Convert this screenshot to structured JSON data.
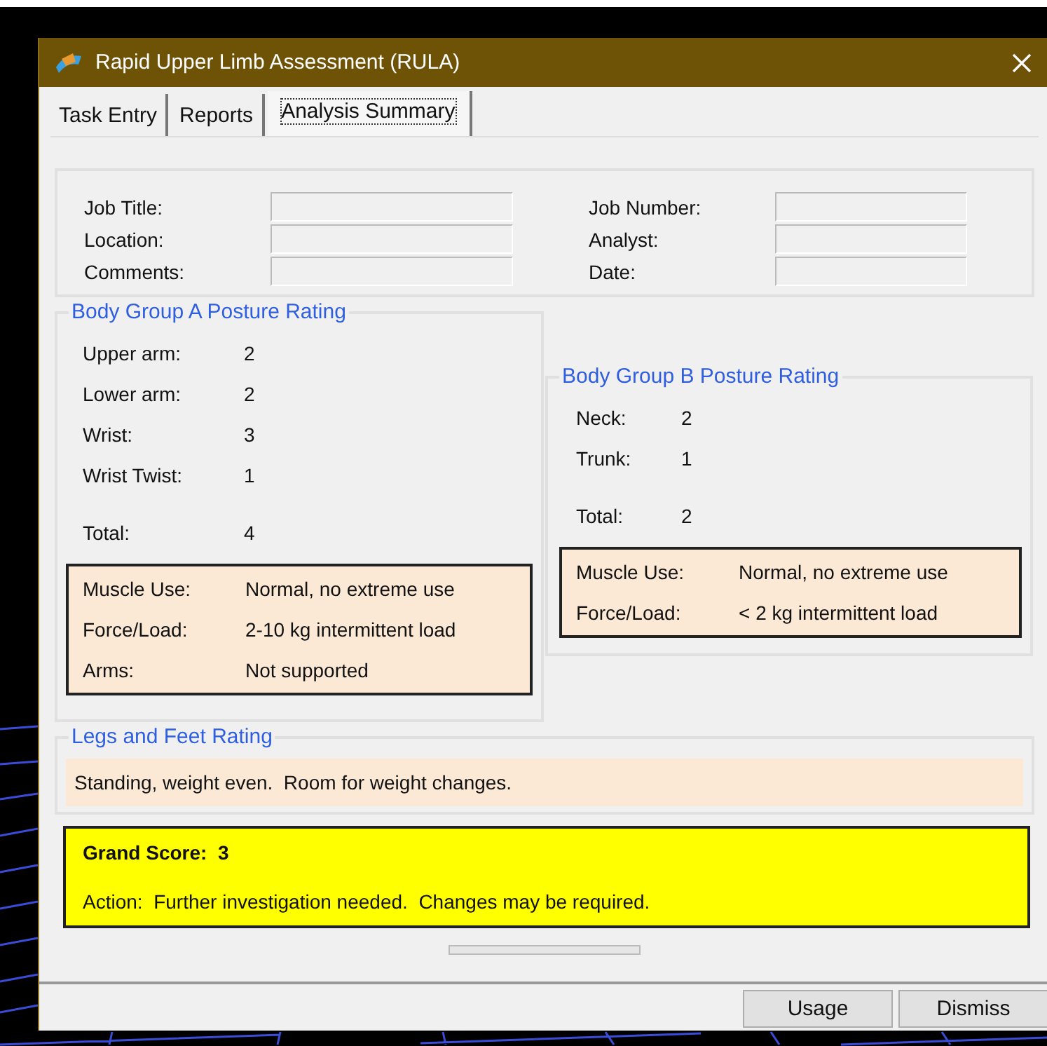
{
  "window": {
    "title": "Rapid Upper Limb Assessment (RULA)"
  },
  "tabs": [
    {
      "label": "Task Entry",
      "selected": false
    },
    {
      "label": "Reports",
      "selected": false
    },
    {
      "label": "Analysis Summary",
      "selected": true
    }
  ],
  "job_info": {
    "left": [
      {
        "label": "Job Title:"
      },
      {
        "label": "Location:"
      },
      {
        "label": "Comments:"
      }
    ],
    "right": [
      {
        "label": "Job Number:"
      },
      {
        "label": "Analyst:"
      },
      {
        "label": "Date:"
      }
    ]
  },
  "group_a": {
    "title": "Body Group A Posture Rating",
    "scores": [
      {
        "label": "Upper arm:",
        "value": "2"
      },
      {
        "label": "Lower arm:",
        "value": "2"
      },
      {
        "label": "Wrist:",
        "value": "3"
      },
      {
        "label": "Wrist Twist:",
        "value": "1"
      }
    ],
    "total": {
      "label": "Total:",
      "value": "4"
    },
    "factors": [
      {
        "label": "Muscle Use:",
        "value": "Normal, no extreme use"
      },
      {
        "label": "Force/Load:",
        "value": "2-10 kg intermittent load"
      },
      {
        "label": "Arms:",
        "value": "Not supported"
      }
    ]
  },
  "group_b": {
    "title": "Body Group B Posture Rating",
    "scores": [
      {
        "label": "Neck:",
        "value": "2"
      },
      {
        "label": "Trunk:",
        "value": "1"
      }
    ],
    "total": {
      "label": "Total:",
      "value": "2"
    },
    "factors": [
      {
        "label": "Muscle Use:",
        "value": "Normal, no extreme use"
      },
      {
        "label": "Force/Load:",
        "value": "< 2 kg intermittent load"
      }
    ]
  },
  "legs": {
    "title": "Legs and Feet Rating",
    "text": "Standing, weight even.  Room for weight changes."
  },
  "result": {
    "grand_score": "Grand Score:  3",
    "action": "Action:  Further investigation needed.  Changes may be required."
  },
  "buttons": [
    "Usage",
    "Dismiss"
  ]
}
